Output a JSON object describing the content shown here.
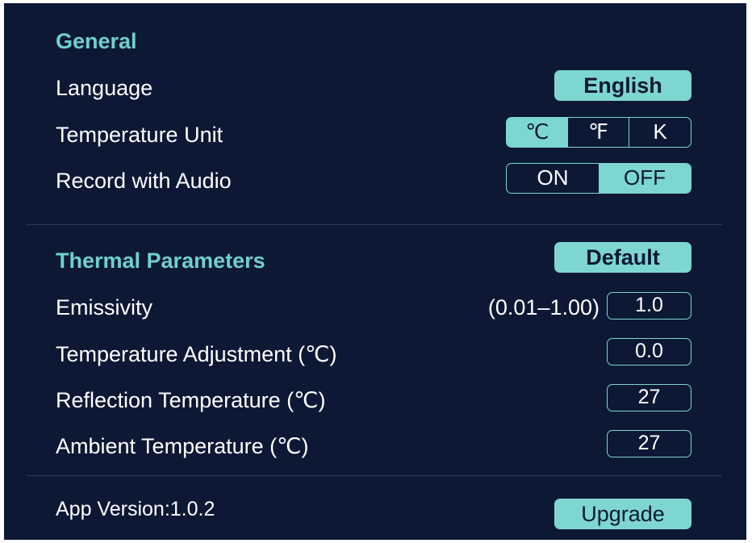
{
  "general": {
    "title": "General",
    "language": {
      "label": "Language",
      "value": "English"
    },
    "temperature_unit": {
      "label": "Temperature Unit",
      "options": [
        "℃",
        "℉",
        "K"
      ],
      "selected": "℃"
    },
    "record_audio": {
      "label": "Record with Audio",
      "options": [
        "ON",
        "OFF"
      ],
      "selected": "OFF"
    }
  },
  "thermal": {
    "title": "Thermal Parameters",
    "default_label": "Default",
    "emissivity": {
      "label": "Emissivity",
      "range": "(0.01–1.00)",
      "value": "1.0"
    },
    "temp_adjust": {
      "label": "Temperature Adjustment (℃)",
      "value": "0.0"
    },
    "reflection_temp": {
      "label": "Reflection Temperature (℃)",
      "value": "27"
    },
    "ambient_temp": {
      "label": "Ambient Temperature (℃)",
      "value": "27"
    }
  },
  "footer": {
    "version_text": "App Version:1.0.2",
    "upgrade_label": "Upgrade"
  },
  "colors": {
    "background": "#0c1834",
    "accent": "#7dd6cf",
    "section_title": "#6fd1c9"
  }
}
